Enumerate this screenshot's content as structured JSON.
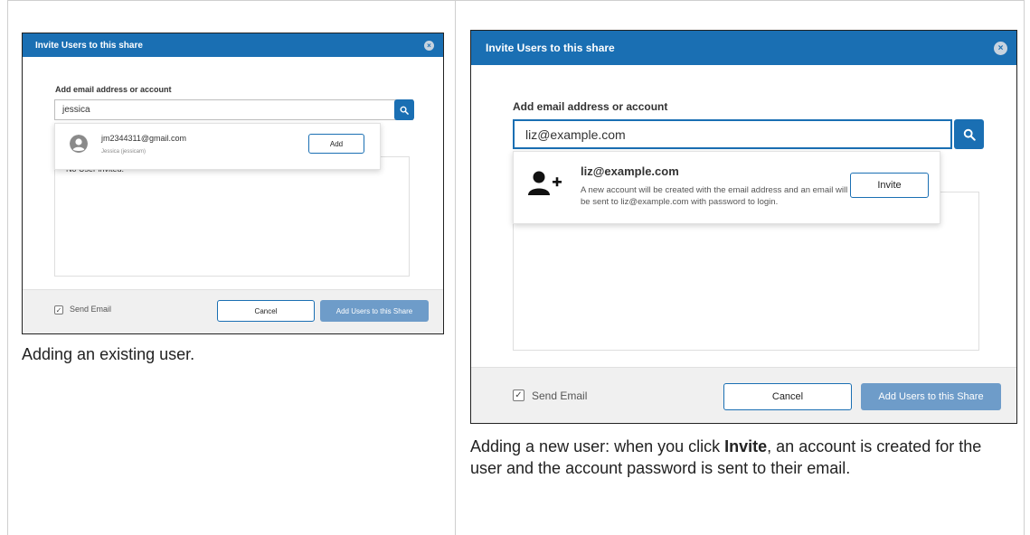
{
  "small_dialog": {
    "title": "Invite Users to this share",
    "close": "×",
    "field_label": "Add email address or account",
    "search_value": "jessica",
    "result_email": "jm2344311@gmail.com",
    "result_name": "Jessica (jessicam)",
    "add_label": "Add",
    "list_empty": "No User invited.",
    "send_email_label": "Send Email",
    "cancel_label": "Cancel",
    "submit_label": "Add Users to this Share"
  },
  "large_dialog": {
    "title": "Invite Users to this share",
    "close": "×",
    "field_label": "Add email address or account",
    "search_value": "liz@example.com",
    "result_email": "liz@example.com",
    "result_desc": "A new account will be created with the email address and an email will be sent to liz@example.com with password to login.",
    "invite_label": "Invite",
    "send_email_label": "Send Email",
    "cancel_label": "Cancel",
    "submit_label": "Add Users to this Share"
  },
  "captions": {
    "left": "Adding an existing user.",
    "right_prefix": "Adding a new user: when you click ",
    "right_bold": "Invite",
    "right_suffix": ", an account is created for the user and the account password is sent to their email."
  },
  "colors": {
    "accent": "#1a6fb3",
    "primary_disabled": "#6e9cc9",
    "footer_bg": "#f0f0f0"
  },
  "icons": {
    "close": "close-icon",
    "search": "search-icon",
    "avatar": "avatar-icon",
    "add_user": "user-plus-icon",
    "checkbox": "checkbox-checked-icon"
  }
}
